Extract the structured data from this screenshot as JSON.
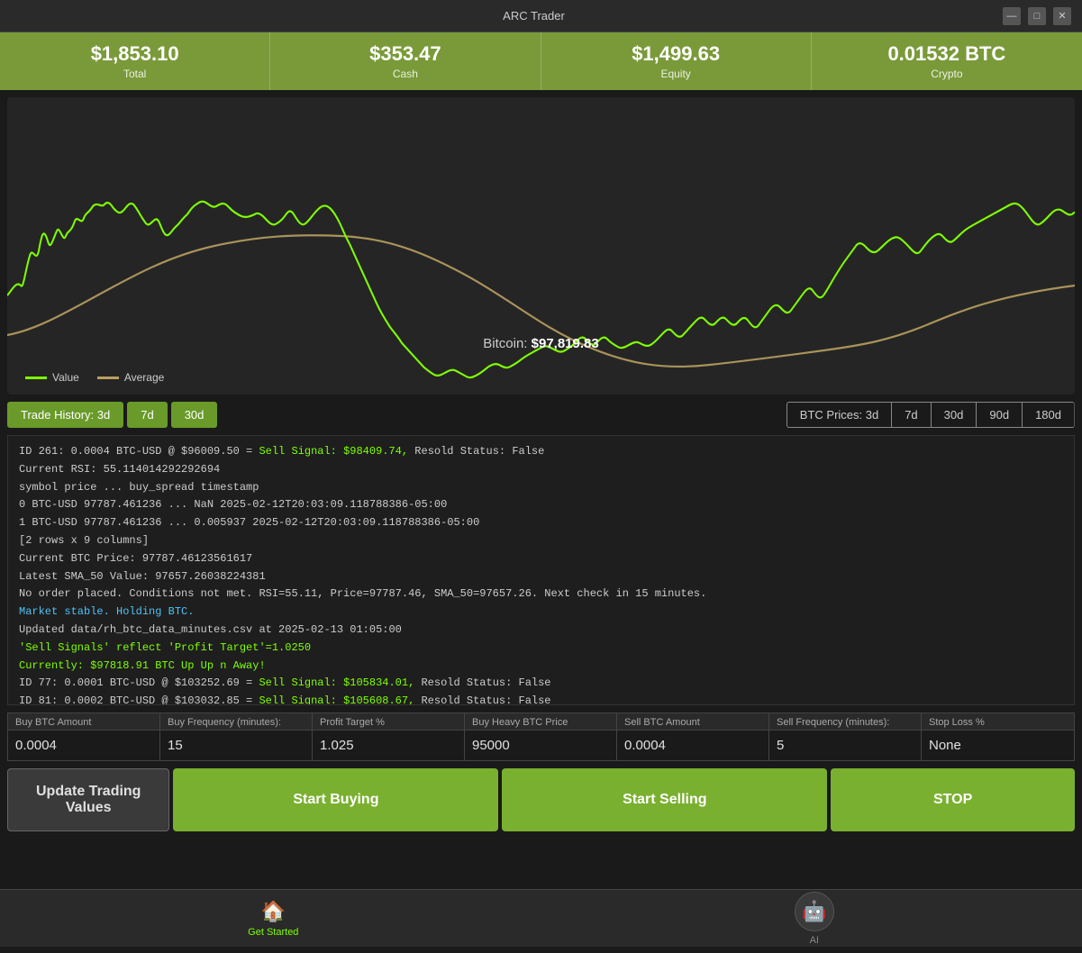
{
  "window": {
    "title": "ARC Trader"
  },
  "titlebar": {
    "minimize_label": "—",
    "maximize_label": "□",
    "close_label": "✕"
  },
  "stats": {
    "total_value": "$1,853.10",
    "total_label": "Total",
    "cash_value": "$353.47",
    "cash_label": "Cash",
    "equity_value": "$1,499.63",
    "equity_label": "Equity",
    "crypto_value": "0.01532 BTC",
    "crypto_label": "Crypto"
  },
  "chart": {
    "price_label": "Bitcoin:",
    "price_value": "$97,819.83",
    "legend_value": "Value",
    "legend_average": "Average"
  },
  "period_buttons": {
    "trade_3d": "Trade History: 3d",
    "trade_7d": "7d",
    "trade_30d": "30d",
    "btc_3d": "BTC Prices: 3d",
    "btc_7d": "7d",
    "btc_30d": "30d",
    "btc_90d": "90d",
    "btc_180d": "180d"
  },
  "log": {
    "lines": [
      "ID 261: 0.0004 BTC-USD @ $96009.50 = Sell Signal: $98409.74, Resold Status: False",
      "Current RSI: 55.114014292292694",
      "    symbol        price  ...  buy_spread                              timestamp",
      "0  BTC-USD  97787.461236  ...         NaN  2025-02-12T20:03:09.118788386-05:00",
      "1  BTC-USD  97787.461236  ...    0.005937  2025-02-12T20:03:09.118788386-05:00",
      "",
      "[2 rows x 9 columns]",
      "Current BTC Price: 97787.46123561617",
      "Latest SMA_50 Value: 97657.26038224381",
      "No order placed. Conditions not met. RSI=55.11, Price=97787.46, SMA_50=97657.26. Next check in 15 minutes.",
      "Market stable. Holding BTC.",
      "Updated data/rh_btc_data_minutes.csv at 2025-02-13 01:05:00",
      "'Sell Signals' reflect 'Profit Target'=1.0250",
      "Currently: $97818.91 BTC Up Up n Away!",
      "ID 77: 0.0001 BTC-USD @ $103252.69 = Sell Signal: $105834.01, Resold Status: False",
      "ID 81: 0.0002 BTC-USD @ $103032.85 = Sell Signal: $105608.67, Resold Status: False"
    ]
  },
  "trading": {
    "buy_btc_amount_label": "Buy BTC Amount",
    "buy_btc_amount_value": "0.0004",
    "buy_freq_label": "Buy Frequency (minutes):",
    "buy_freq_value": "15",
    "profit_target_label": "Profit Target %",
    "profit_target_value": "1.025",
    "buy_heavy_label": "Buy Heavy BTC Price",
    "buy_heavy_value": "95000",
    "sell_btc_label": "Sell BTC Amount",
    "sell_btc_value": "0.0004",
    "sell_freq_label": "Sell Frequency (minutes):",
    "sell_freq_value": "5",
    "stop_loss_label": "Stop Loss %",
    "stop_loss_value": "None"
  },
  "buttons": {
    "update": "Update Trading Values",
    "buy": "Start Buying",
    "sell": "Start Selling",
    "stop": "STOP"
  },
  "nav": {
    "home_label": "Get Started",
    "ai_label": "AI"
  }
}
